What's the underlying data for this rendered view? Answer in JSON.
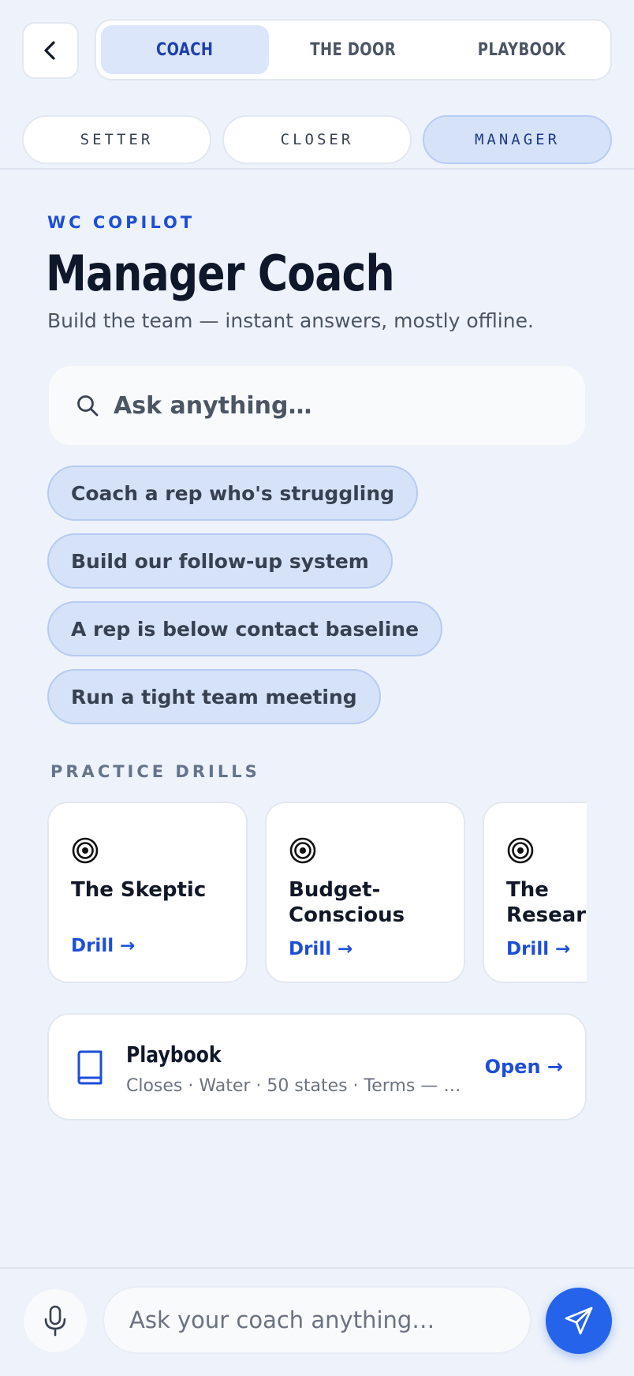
{
  "nav": {
    "tabs": [
      {
        "label": "COACH",
        "active": true
      },
      {
        "label": "THE DOOR",
        "active": false
      },
      {
        "label": "PLAYBOOK",
        "active": false
      }
    ],
    "back_icon": "chevron-left-icon"
  },
  "roles": [
    {
      "label": "SETTER",
      "active": false
    },
    {
      "label": "CLOSER",
      "active": false
    },
    {
      "label": "MANAGER",
      "active": true
    }
  ],
  "header": {
    "eyebrow": "WC COPILOT",
    "title": "Manager Coach",
    "subtitle": "Build the team — instant answers, mostly offline."
  },
  "search": {
    "placeholder": "Ask anything…",
    "icon": "search-icon"
  },
  "suggestions": [
    "Coach a rep who's struggling",
    "Build our follow-up system",
    "A rep is below contact baseline",
    "Run a tight team meeting"
  ],
  "drills": {
    "section_label": "PRACTICE DRILLS",
    "items": [
      {
        "name": "The Skeptic",
        "link": "Drill →",
        "icon": "target-icon"
      },
      {
        "name": "Budget-Conscious",
        "link": "Drill →",
        "icon": "target-icon"
      },
      {
        "name": "The Researcher",
        "link": "Drill →",
        "icon": "target-icon"
      }
    ]
  },
  "playbook": {
    "title": "Playbook",
    "subtitle": "Closes · Water · 50 states · Terms — s…",
    "open_label": "Open →",
    "icon": "book-icon"
  },
  "composer": {
    "placeholder": "Ask your coach anything…",
    "mic_icon": "microphone-icon",
    "send_icon": "send-icon"
  },
  "colors": {
    "accent": "#2563eb",
    "accent_text": "#1d4ed8",
    "chip_bg": "#d6e2f8",
    "page_bg": "#eef2fa"
  }
}
